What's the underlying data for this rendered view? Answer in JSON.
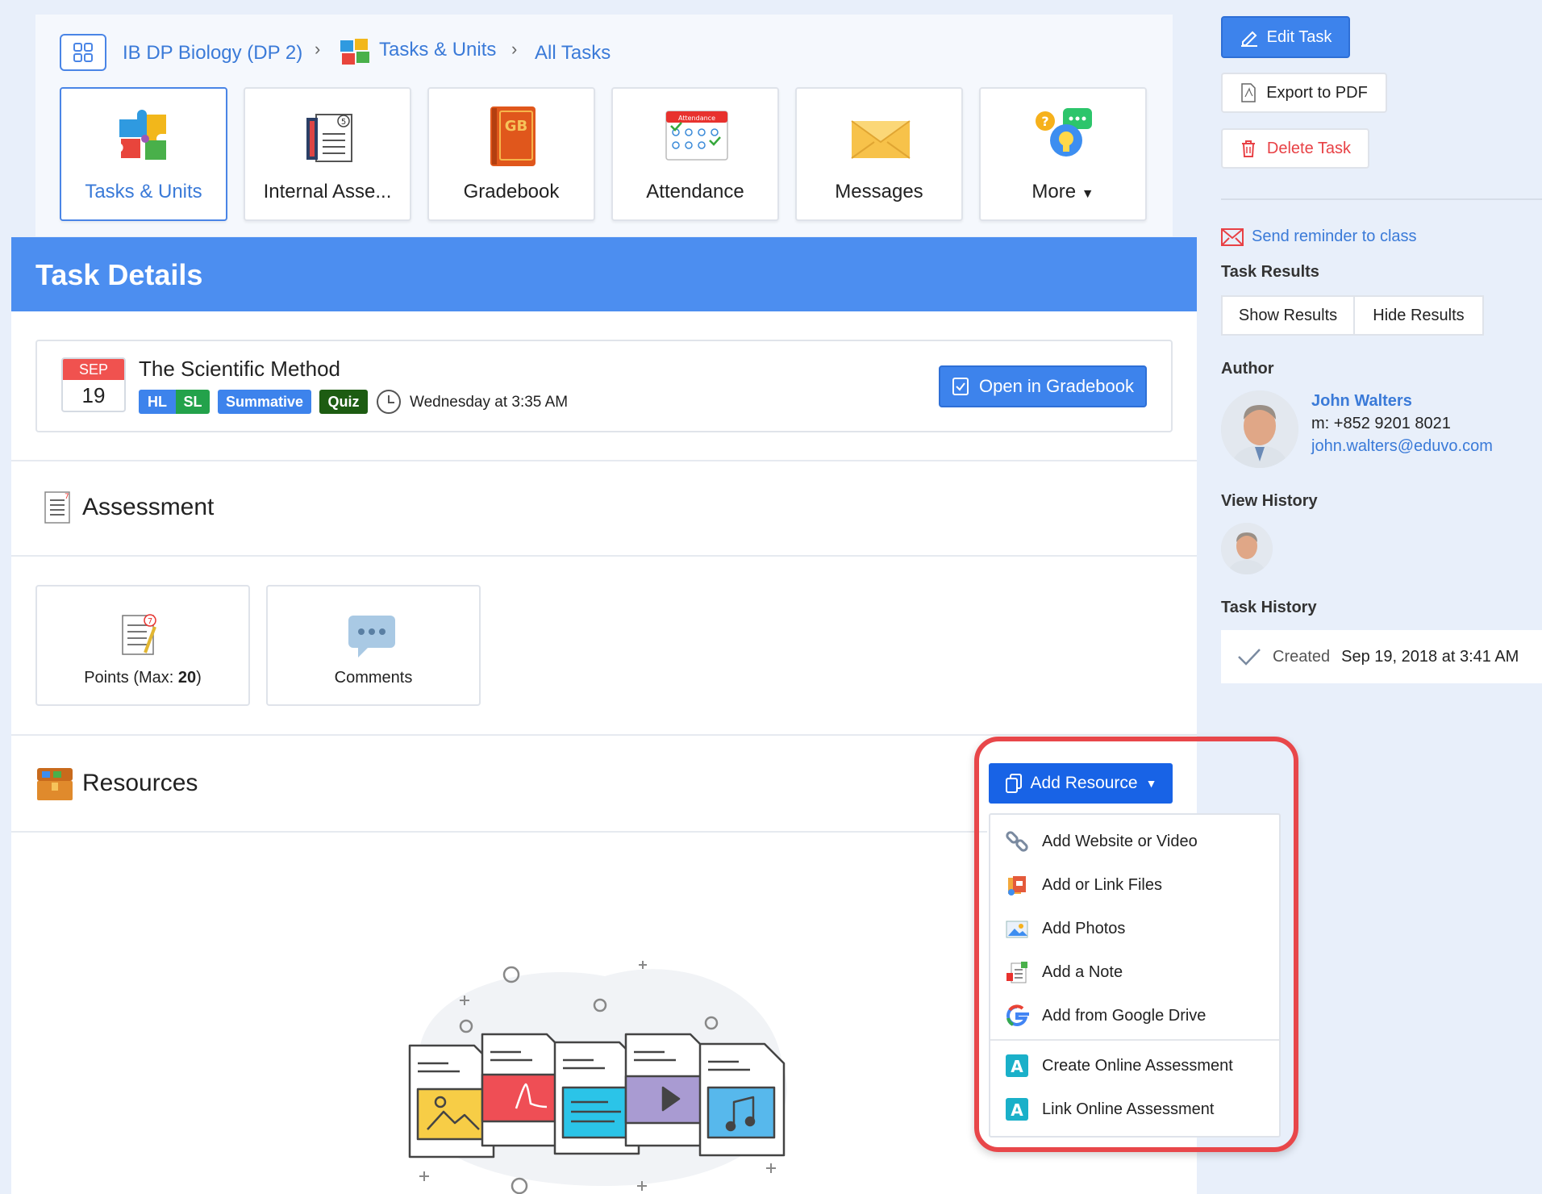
{
  "breadcrumb": {
    "course": "IB DP Biology (DP 2)",
    "section": "Tasks & Units",
    "current": "All Tasks"
  },
  "tiles": [
    {
      "label": "Tasks & Units",
      "icon": "puzzle-icon",
      "active": true
    },
    {
      "label": "Internal Asse...",
      "icon": "internal-assessment-icon",
      "active": false
    },
    {
      "label": "Gradebook",
      "icon": "gradebook-icon",
      "active": false
    },
    {
      "label": "Attendance",
      "icon": "attendance-icon",
      "active": false
    },
    {
      "label": "Messages",
      "icon": "envelope-icon",
      "active": false
    },
    {
      "label": "More",
      "icon": "chat-bulb-icon",
      "active": false
    }
  ],
  "gradebook_icon_text": "GB",
  "attendance_icon_text": "Attendance",
  "task_details": {
    "header": "Task Details",
    "date_month": "SEP",
    "date_day": "19",
    "title": "The Scientific Method",
    "tags": [
      {
        "label": "HL",
        "color": "#3d83ec"
      },
      {
        "label": "SL",
        "color": "#23a24b"
      },
      {
        "label": "Summative",
        "color": "#3d83ec"
      },
      {
        "label": "Quiz",
        "color": "#1d5c12"
      }
    ],
    "due": "Wednesday at 3:35 AM",
    "open_gradebook": "Open in Gradebook"
  },
  "assessment": {
    "title": "Assessment",
    "points_label": "Points (Max: ",
    "points_max": "20",
    "points_close": ")",
    "comments_label": "Comments"
  },
  "resources": {
    "title": "Resources",
    "add_button": "Add Resource",
    "menu": [
      {
        "label": "Add Website or Video",
        "icon": "link-icon"
      },
      {
        "label": "Add or Link Files",
        "icon": "files-icon"
      },
      {
        "label": "Add Photos",
        "icon": "photo-icon"
      },
      {
        "label": "Add a Note",
        "icon": "note-icon"
      },
      {
        "label": "Add from Google Drive",
        "icon": "google-drive-icon"
      },
      {
        "label": "Create Online Assessment",
        "icon": "online-assessment-icon"
      },
      {
        "label": "Link Online Assessment",
        "icon": "online-assessment-icon"
      }
    ],
    "assessment_icon_letter": "A"
  },
  "sidebar": {
    "edit": "Edit Task",
    "export": "Export to PDF",
    "delete": "Delete Task",
    "reminder": "Send reminder to class",
    "results_heading": "Task Results",
    "show_results": "Show Results",
    "hide_results": "Hide Results",
    "author_heading": "Author",
    "author_name": "John Walters",
    "author_phone": "m: +852 9201 8021",
    "author_email": "john.walters@eduvo.com",
    "view_history_heading": "View History",
    "task_history_heading": "Task History",
    "history_label": "Created",
    "history_date": "Sep 19, 2018 at 3:41 AM"
  },
  "colors": {
    "accent": "#3d83ec",
    "header_bg": "#4c8ef0",
    "danger": "#e84145",
    "highlight": "#e8474a",
    "page_bg": "#e8effa"
  }
}
